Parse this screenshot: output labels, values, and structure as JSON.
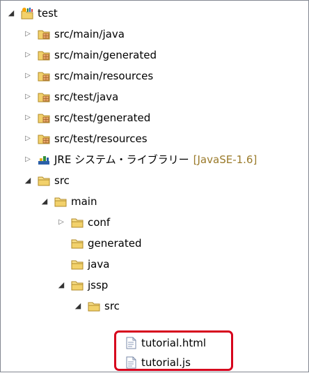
{
  "tree": {
    "project": {
      "label": "test",
      "icon": "java-project-icon"
    },
    "source_folders": [
      {
        "label": "src/main/java",
        "icon": "package-folder-icon"
      },
      {
        "label": "src/main/generated",
        "icon": "package-folder-icon"
      },
      {
        "label": "src/main/resources",
        "icon": "package-folder-icon"
      },
      {
        "label": "src/test/java",
        "icon": "package-folder-icon"
      },
      {
        "label": "src/test/generated",
        "icon": "package-folder-icon"
      },
      {
        "label": "src/test/resources",
        "icon": "package-folder-icon"
      }
    ],
    "jre": {
      "label": "JRE システム・ライブラリー",
      "suffix": "[JavaSE-1.6]",
      "icon": "library-icon"
    },
    "src": {
      "label": "src",
      "icon": "folder-icon"
    },
    "main": {
      "label": "main",
      "icon": "folder-icon"
    },
    "conf": {
      "label": "conf",
      "icon": "folder-icon"
    },
    "generated": {
      "label": "generated",
      "icon": "folder-icon"
    },
    "java": {
      "label": "java",
      "icon": "folder-icon"
    },
    "jssp": {
      "label": "jssp",
      "icon": "folder-icon"
    },
    "jssp_src": {
      "label": "src",
      "icon": "folder-icon"
    },
    "files": [
      {
        "label": "tutorial.html",
        "icon": "file-icon"
      },
      {
        "label": "tutorial.js",
        "icon": "file-icon"
      }
    ]
  },
  "colors": {
    "highlight": "#d6001c",
    "suffix": "#9a7a2a",
    "folder": "#f2d16b"
  }
}
